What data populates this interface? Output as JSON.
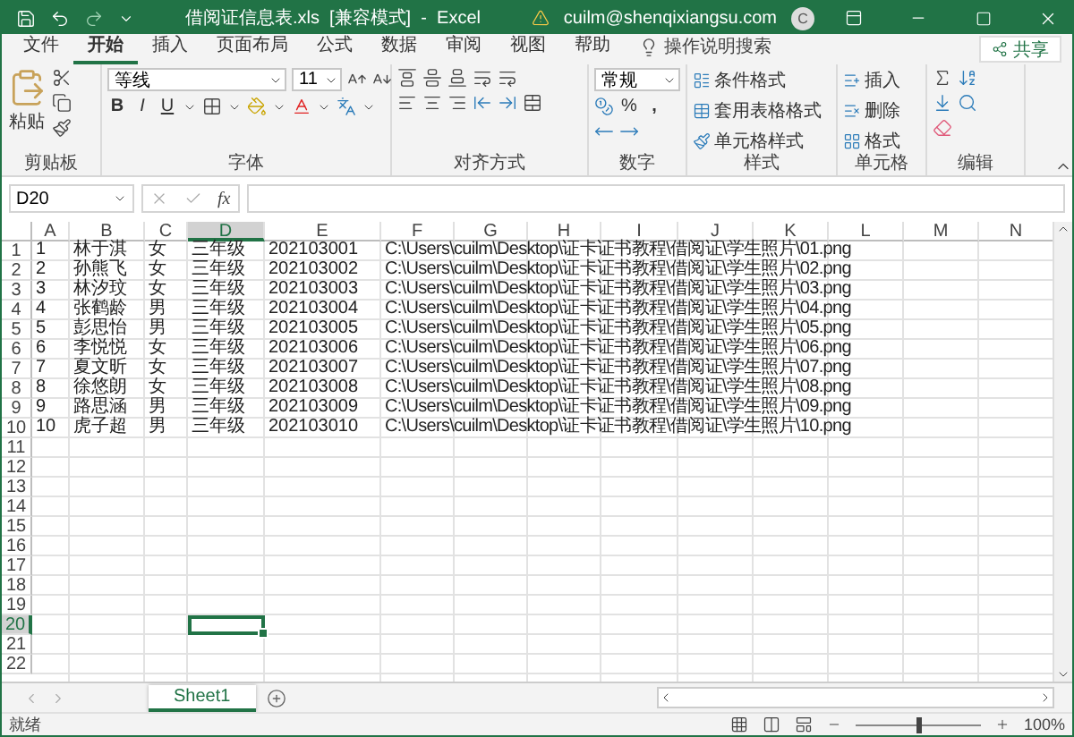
{
  "title_bar": {
    "filename": "借阅证信息表.xls",
    "mode": "[兼容模式]",
    "separator": "-",
    "app": "Excel",
    "account": "cuilm@shenqixiangsu.com",
    "avatar": "C"
  },
  "ribbon_tabs": [
    {
      "label": "文件",
      "selected": false
    },
    {
      "label": "开始",
      "selected": true
    },
    {
      "label": "插入",
      "selected": false
    },
    {
      "label": "页面布局",
      "selected": false
    },
    {
      "label": "公式",
      "selected": false
    },
    {
      "label": "数据",
      "selected": false
    },
    {
      "label": "审阅",
      "selected": false
    },
    {
      "label": "视图",
      "selected": false
    },
    {
      "label": "帮助",
      "selected": false
    }
  ],
  "tell_me": "操作说明搜索",
  "share": "共享",
  "clipboard": {
    "label": "剪贴板",
    "paste": "粘贴"
  },
  "font": {
    "label": "字体",
    "font_name": "等线",
    "font_size": "11",
    "bold": "B",
    "italic": "I",
    "underline": "U"
  },
  "alignment": {
    "label": "对齐方式"
  },
  "number": {
    "label": "数字",
    "format": "常规",
    "percent": "%",
    "comma": ","
  },
  "styles": {
    "label": "样式",
    "items": [
      "条件格式",
      "套用表格格式",
      "单元格样式"
    ]
  },
  "cells": {
    "label": "单元格",
    "items": [
      "插入",
      "删除",
      "格式"
    ]
  },
  "editing": {
    "label": "编辑"
  },
  "formula_bar": {
    "name_box": "D20",
    "fx": "fx"
  },
  "sheet": {
    "columns": [
      {
        "label": "A",
        "selected": false
      },
      {
        "label": "B",
        "selected": false
      },
      {
        "label": "C",
        "selected": false
      },
      {
        "label": "D",
        "selected": true
      },
      {
        "label": "E",
        "selected": false
      },
      {
        "label": "F",
        "selected": false
      },
      {
        "label": "G",
        "selected": false
      },
      {
        "label": "H",
        "selected": false
      },
      {
        "label": "I",
        "selected": false
      },
      {
        "label": "J",
        "selected": false
      },
      {
        "label": "K",
        "selected": false
      },
      {
        "label": "L",
        "selected": false
      },
      {
        "label": "M",
        "selected": false
      },
      {
        "label": "N",
        "selected": false
      }
    ],
    "rows": [
      {
        "number": "1",
        "selected": false,
        "cells": [
          "1",
          "林于淇",
          "女",
          "三年级",
          "202103001",
          "C:\\Users\\cuilm\\Desktop\\证卡证书教程\\借阅证\\学生照片\\01.png"
        ]
      },
      {
        "number": "2",
        "selected": false,
        "cells": [
          "2",
          "孙熊飞",
          "女",
          "三年级",
          "202103002",
          "C:\\Users\\cuilm\\Desktop\\证卡证书教程\\借阅证\\学生照片\\02.png"
        ]
      },
      {
        "number": "3",
        "selected": false,
        "cells": [
          "3",
          "林汐玟",
          "女",
          "三年级",
          "202103003",
          "C:\\Users\\cuilm\\Desktop\\证卡证书教程\\借阅证\\学生照片\\03.png"
        ]
      },
      {
        "number": "4",
        "selected": false,
        "cells": [
          "4",
          "张鹤龄",
          "男",
          "三年级",
          "202103004",
          "C:\\Users\\cuilm\\Desktop\\证卡证书教程\\借阅证\\学生照片\\04.png"
        ]
      },
      {
        "number": "5",
        "selected": false,
        "cells": [
          "5",
          "彭思怡",
          "男",
          "三年级",
          "202103005",
          "C:\\Users\\cuilm\\Desktop\\证卡证书教程\\借阅证\\学生照片\\05.png"
        ]
      },
      {
        "number": "6",
        "selected": false,
        "cells": [
          "6",
          "李悦悦",
          "女",
          "三年级",
          "202103006",
          "C:\\Users\\cuilm\\Desktop\\证卡证书教程\\借阅证\\学生照片\\06.png"
        ]
      },
      {
        "number": "7",
        "selected": false,
        "cells": [
          "7",
          "夏文昕",
          "女",
          "三年级",
          "202103007",
          "C:\\Users\\cuilm\\Desktop\\证卡证书教程\\借阅证\\学生照片\\07.png"
        ]
      },
      {
        "number": "8",
        "selected": false,
        "cells": [
          "8",
          "徐悠朗",
          "女",
          "三年级",
          "202103008",
          "C:\\Users\\cuilm\\Desktop\\证卡证书教程\\借阅证\\学生照片\\08.png"
        ]
      },
      {
        "number": "9",
        "selected": false,
        "cells": [
          "9",
          "路思涵",
          "男",
          "三年级",
          "202103009",
          "C:\\Users\\cuilm\\Desktop\\证卡证书教程\\借阅证\\学生照片\\09.png"
        ]
      },
      {
        "number": "10",
        "selected": false,
        "cells": [
          "10",
          "虎子超",
          "男",
          "三年级",
          "202103010",
          "C:\\Users\\cuilm\\Desktop\\证卡证书教程\\借阅证\\学生照片\\10.png"
        ]
      },
      {
        "number": "11",
        "selected": false,
        "cells": []
      },
      {
        "number": "12",
        "selected": false,
        "cells": []
      },
      {
        "number": "13",
        "selected": false,
        "cells": []
      },
      {
        "number": "14",
        "selected": false,
        "cells": []
      },
      {
        "number": "15",
        "selected": false,
        "cells": []
      },
      {
        "number": "16",
        "selected": false,
        "cells": []
      },
      {
        "number": "17",
        "selected": false,
        "cells": []
      },
      {
        "number": "18",
        "selected": false,
        "cells": []
      },
      {
        "number": "19",
        "selected": false,
        "cells": []
      },
      {
        "number": "20",
        "selected": true,
        "cells": []
      },
      {
        "number": "21",
        "selected": false,
        "cells": []
      },
      {
        "number": "22",
        "selected": false,
        "cells": []
      }
    ]
  },
  "sheet_tabs": [
    {
      "label": "Sheet1",
      "selected": true
    }
  ],
  "status_bar": {
    "status": "就绪",
    "zoom_slider": {
      "level": 0.5
    },
    "zoom": "100%"
  }
}
